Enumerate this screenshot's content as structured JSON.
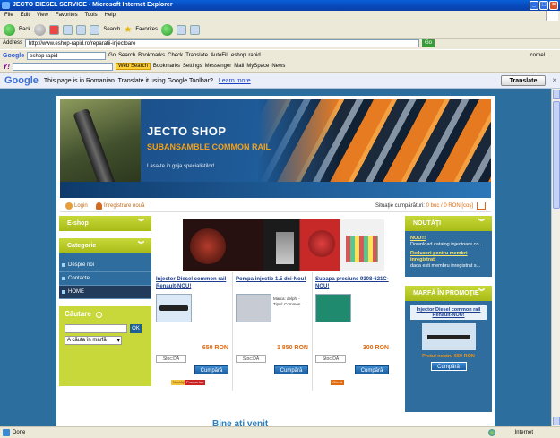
{
  "window": {
    "title": "JECTO DIESEL SERVICE - Microsoft Internet Explorer"
  },
  "menu": [
    "File",
    "Edit",
    "View",
    "Favorites",
    "Tools",
    "Help"
  ],
  "toolbar": {
    "back": "Back",
    "search": "Search",
    "favorites": "Favorites"
  },
  "address": {
    "label": "Address",
    "url": "http://www.eshop-rapid.ro/reparatii-injectoare",
    "go": "Go"
  },
  "googlebar": {
    "logo": "Google",
    "query": "eshop rapid",
    "items": [
      "Go",
      "Search",
      "Bookmarks",
      "Check",
      "Translate",
      "AutoFill",
      "eshop",
      "rapid"
    ],
    "user": "cornel..."
  },
  "yahoobar": {
    "logo": "Y!",
    "web_search": "Web Search",
    "items": [
      "Bookmarks",
      "Settings",
      "Messenger",
      "Mail",
      "MySpace",
      "News"
    ]
  },
  "translate": {
    "logo": "Google",
    "message": "This page is in Romanian.  Translate it using Google Toolbar?",
    "learn_more": "Learn more",
    "button": "Translate"
  },
  "site": {
    "banner": {
      "title": "JECTO SHOP",
      "subtitle": "SUBANSAMBLE COMMON RAIL",
      "tagline": "Lasa-te in grija specialistilor!"
    },
    "topbar": {
      "login": "Login",
      "register": "Înregistrare nouă",
      "cart_label": "Situaţie cumpărături:",
      "cart_value": "0 buc / 0 RON [coş]"
    },
    "left": {
      "eshop": "E-shop",
      "categorie": "Categorie",
      "categories": [
        "Despre noi",
        "Contacte",
        "HOME"
      ],
      "search_title": "Căutare",
      "search_ok": "OK",
      "search_scope": "A căuta în marfă"
    },
    "products": [
      {
        "name": "Injector Diesel common rail Renault-NOU!",
        "desc": "",
        "price": "650 RON",
        "stock": "Stoc:DA",
        "buy": "Cumpără",
        "badges": [
          "Noutăţi",
          "Produs top"
        ]
      },
      {
        "name": "Pompa injectie 1.5 dci-Nou!",
        "desc": "Marca: delphi - Tipul: Common ...",
        "price": "1 850 RON",
        "stock": "Stoc:DA",
        "buy": "Cumpără",
        "badges": []
      },
      {
        "name": "Supapa presiune 9308-621C-NOU!",
        "desc": "",
        "price": "300 RON",
        "stock": "Stoc:DA",
        "buy": "Cumpără",
        "badges": [
          "Ofertă"
        ]
      }
    ],
    "welcome": "Bine ati venit",
    "right": {
      "news_title": "NOUTĂŢI",
      "news": [
        {
          "title": "NOU!!!",
          "text": "Download catalog injectoare co..."
        },
        {
          "title": "Reduceri pentru membri inregistrati",
          "text": "daca esti membru inregistrat s..."
        }
      ],
      "promo_title": "MARFĂ ÎN PROMOŢIE",
      "promo": {
        "name": "Injector Diesel common rail Renault-NOU!",
        "price": "Pretul nostru 650 RON",
        "buy": "Cumpără"
      }
    }
  },
  "status": {
    "left": "Done",
    "zone": "Internet"
  }
}
